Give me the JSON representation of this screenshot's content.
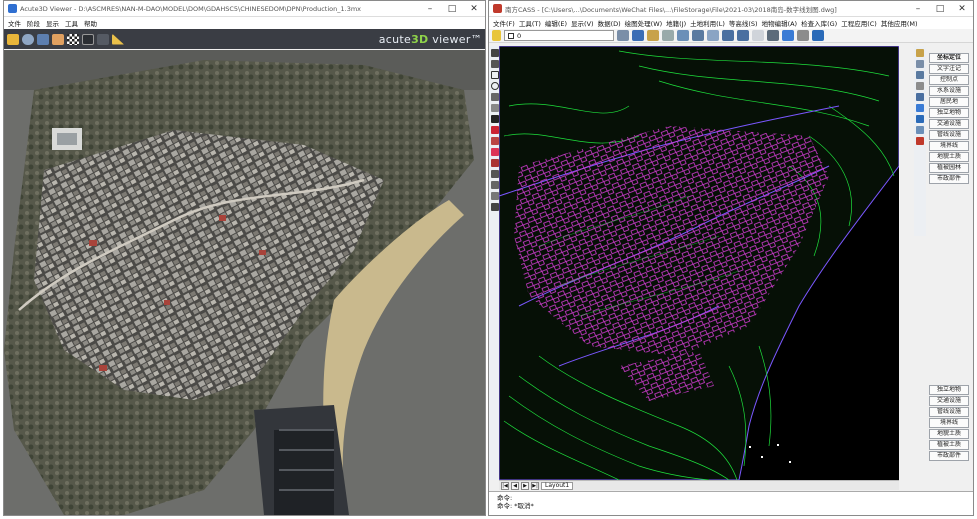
{
  "left_window": {
    "title": "Acute3D Viewer - D:\\ASCMRES\\NAN-M-DAO\\MODEL\\DOM\\GDAHSC5\\CHINESEDOM\\DPN\\Production_1.3mx",
    "menu": [
      "文件",
      "阶段",
      "显示",
      "工具",
      "帮助"
    ],
    "brand_prefix": "acute",
    "brand_3d": "3D",
    "brand_suffix": " viewer"
  },
  "right_window": {
    "title": "南方CASS - [C:\\Users\\...\\Documents\\WeChat Files\\...\\FileStorage\\File\\2021-03\\2018南岛-数字线划图.dwg]",
    "menu": [
      "文件(F)",
      "工具(T)",
      "编辑(E)",
      "显示(V)",
      "数据(D)",
      "绘图处理(W)",
      "地籍(J)",
      "土地利用(L)",
      "等高线(S)",
      "地物编辑(A)",
      "检查入库(G)",
      "工程应用(C)",
      "其他应用(M)"
    ],
    "layer_value": "0",
    "right_panel_top": [
      "坐标定位",
      "文字注记",
      "控制点",
      "水系设施",
      "居民地",
      "独立地物",
      "交通设施",
      "管线设施",
      "境界线",
      "地貌土质",
      "植被园林",
      "市政部件"
    ],
    "right_panel_bottom": [
      "独立地物",
      "交通设施",
      "管线设施",
      "境界线",
      "地貌土质",
      "植被土质",
      "市政部件"
    ],
    "layout_tab": "Layout1",
    "command_line_1": "命令:",
    "command_line_2": "命令: *取消*"
  },
  "colors": {
    "contour_green": "#1ee03c",
    "building_magenta": "#d23cd2",
    "road_violet": "#7a57ff",
    "cad_background": "#000000"
  }
}
